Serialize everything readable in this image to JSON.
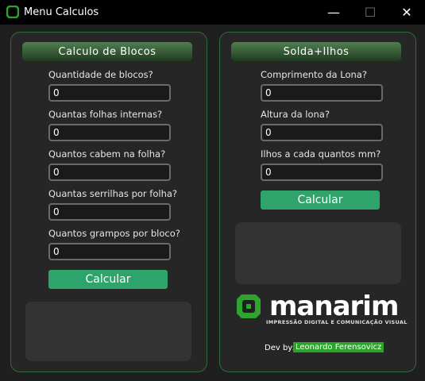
{
  "window": {
    "title": "Menu Calculos",
    "controls": {
      "minimize": "—",
      "maximize": "☐",
      "close": "✕"
    }
  },
  "blocos": {
    "header": "Calculo de Blocos",
    "fields": [
      {
        "label": "Quantidade de blocos?",
        "value": "0"
      },
      {
        "label": "Quantas folhas internas?",
        "value": "0"
      },
      {
        "label": "Quantos cabem na folha?",
        "value": "0"
      },
      {
        "label": "Quantas serrilhas por folha?",
        "value": "0"
      },
      {
        "label": "Quantos grampos por bloco?",
        "value": "0"
      }
    ],
    "button": "Calcular"
  },
  "solda": {
    "header": "Solda+Ilhos",
    "fields": [
      {
        "label": "Comprimento da Lona?",
        "value": "0"
      },
      {
        "label": "Altura da lona?",
        "value": "0"
      },
      {
        "label": "Ilhos a cada quantos mm?",
        "value": "0"
      }
    ],
    "button": "Calcular"
  },
  "brand": {
    "name": "manarim",
    "tagline": "IMPRESSÃO DIGITAL E COMUNICAÇÃO VISUAL",
    "accent": "#2ea32e"
  },
  "credit": {
    "label": "Dev by:",
    "name": "Leonardo Ferensovicz"
  },
  "colors": {
    "button": "#2ea36a",
    "panel_border": "#2f6b3a"
  }
}
